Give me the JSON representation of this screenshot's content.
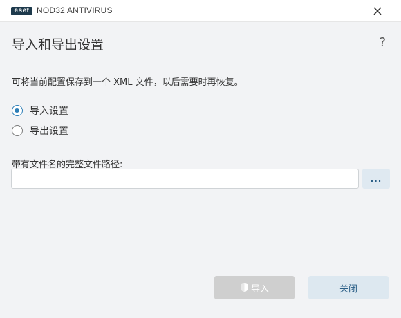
{
  "window": {
    "logo_text": "eset",
    "product_name": "NOD32 ANTIVIRUS"
  },
  "dialog": {
    "title": "导入和导出设置",
    "help_label": "?",
    "description": "可将当前配置保存到一个 XML 文件，以后需要时再恢复。",
    "options": [
      {
        "label": "导入设置",
        "checked": true
      },
      {
        "label": "导出设置",
        "checked": false
      }
    ],
    "path_label": "带有文件名的完整文件路径:",
    "path_value": "",
    "browse_label": "...",
    "import_button": "导入",
    "close_button": "关闭"
  },
  "colors": {
    "accent": "#2b7db6",
    "disabled_button": "#cfcfcf",
    "secondary_button": "#dde8f0",
    "background": "#f2f3f5"
  }
}
